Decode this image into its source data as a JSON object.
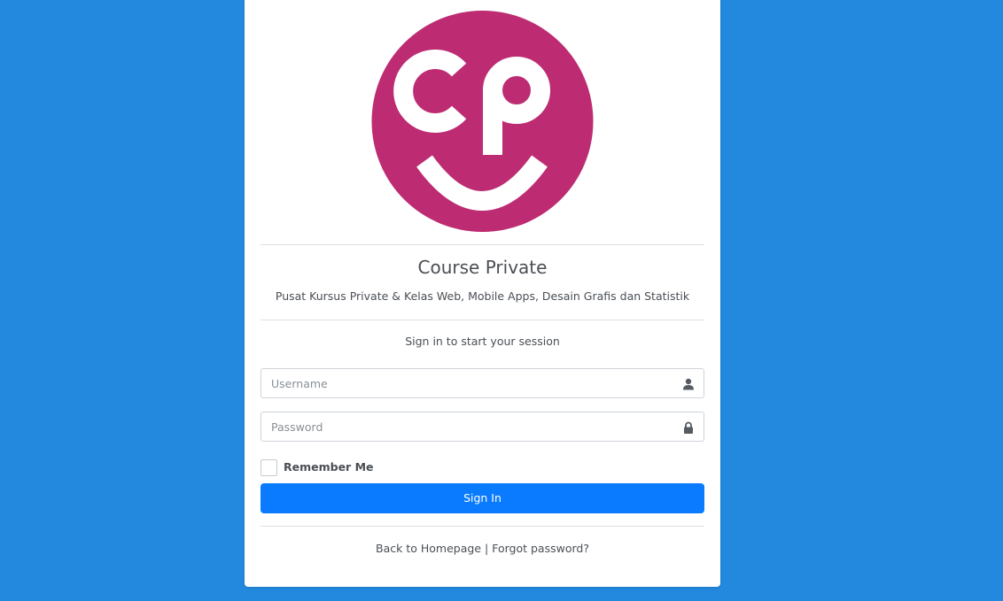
{
  "brand": {
    "logo_color": "#bd2c72",
    "name": "Course Private",
    "tagline": "Pusat Kursus Private & Kelas Web, Mobile Apps, Desain Grafis dan Statistik"
  },
  "login": {
    "message": "Sign in to start your session",
    "username": {
      "placeholder": "Username",
      "value": "",
      "icon": "user-icon"
    },
    "password": {
      "placeholder": "Password",
      "value": "",
      "icon": "lock-icon"
    },
    "remember_label": "Remember Me",
    "remember_checked": false,
    "submit_label": "Sign In"
  },
  "footer": {
    "back_label": "Back to Homepage",
    "separator": "|",
    "forgot_label": "Forgot password?"
  },
  "colors": {
    "page_background": "#2389de",
    "primary_button": "#0a7bff"
  }
}
